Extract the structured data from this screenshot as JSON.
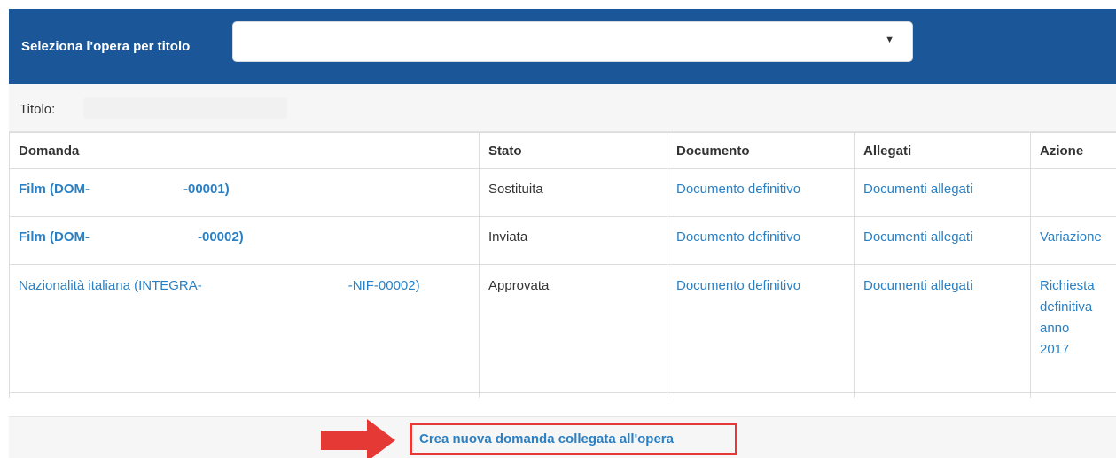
{
  "header": {
    "select_label": "Seleziona l'opera per titolo",
    "select_value": "",
    "select_arrow": "▼"
  },
  "title_row": {
    "label": "Titolo:"
  },
  "table": {
    "columns": [
      "Domanda",
      "Stato",
      "Documento",
      "Allegati",
      "Azione"
    ],
    "rows": [
      {
        "domanda_prefix": "Film (DOM-",
        "domanda_suffix": "-00001)",
        "stato": "Sostituita",
        "documento": "Documento definitivo",
        "allegati": "Documenti allegati",
        "azione": ""
      },
      {
        "domanda_prefix": "Film (DOM-",
        "domanda_suffix": "-00002)",
        "stato": "Inviata",
        "documento": "Documento definitivo",
        "allegati": "Documenti allegati",
        "azione": "Variazione"
      },
      {
        "domanda_prefix": "Nazionalità italiana (INTEGRA-",
        "domanda_suffix": "-NIF-00002)",
        "stato": "Approvata",
        "documento": "Documento definitivo",
        "allegati": "Documenti allegati",
        "azione_lines": [
          "Richiesta",
          "definitiva",
          "anno",
          "2017"
        ]
      }
    ]
  },
  "footer": {
    "create_link": "Crea nuova domanda collegata all'opera",
    "highlight_color": "#e53935"
  },
  "colors": {
    "header_bg": "#1b5698",
    "link": "#2b80c3"
  },
  "icons": {
    "select_arrow": "triangle-down",
    "pointer": "red-arrow-right"
  }
}
